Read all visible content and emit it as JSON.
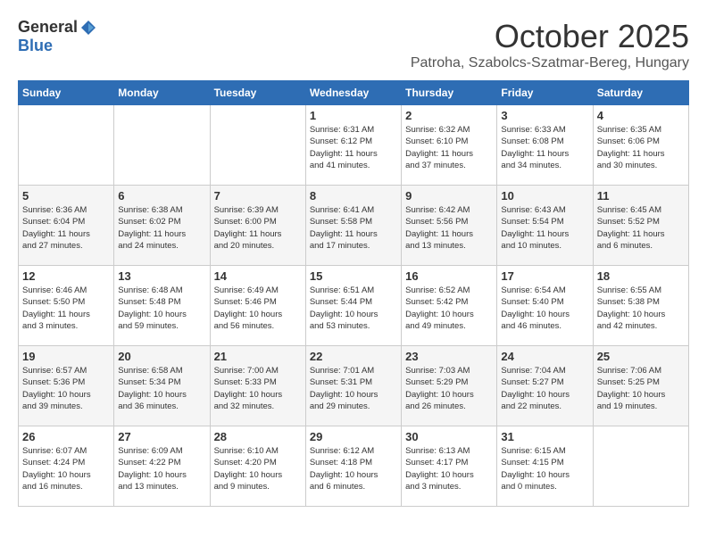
{
  "header": {
    "logo_general": "General",
    "logo_blue": "Blue",
    "month": "October 2025",
    "location": "Patroha, Szabolcs-Szatmar-Bereg, Hungary"
  },
  "weekdays": [
    "Sunday",
    "Monday",
    "Tuesday",
    "Wednesday",
    "Thursday",
    "Friday",
    "Saturday"
  ],
  "weeks": [
    [
      {
        "day": "",
        "info": ""
      },
      {
        "day": "",
        "info": ""
      },
      {
        "day": "",
        "info": ""
      },
      {
        "day": "1",
        "info": "Sunrise: 6:31 AM\nSunset: 6:12 PM\nDaylight: 11 hours\nand 41 minutes."
      },
      {
        "day": "2",
        "info": "Sunrise: 6:32 AM\nSunset: 6:10 PM\nDaylight: 11 hours\nand 37 minutes."
      },
      {
        "day": "3",
        "info": "Sunrise: 6:33 AM\nSunset: 6:08 PM\nDaylight: 11 hours\nand 34 minutes."
      },
      {
        "day": "4",
        "info": "Sunrise: 6:35 AM\nSunset: 6:06 PM\nDaylight: 11 hours\nand 30 minutes."
      }
    ],
    [
      {
        "day": "5",
        "info": "Sunrise: 6:36 AM\nSunset: 6:04 PM\nDaylight: 11 hours\nand 27 minutes."
      },
      {
        "day": "6",
        "info": "Sunrise: 6:38 AM\nSunset: 6:02 PM\nDaylight: 11 hours\nand 24 minutes."
      },
      {
        "day": "7",
        "info": "Sunrise: 6:39 AM\nSunset: 6:00 PM\nDaylight: 11 hours\nand 20 minutes."
      },
      {
        "day": "8",
        "info": "Sunrise: 6:41 AM\nSunset: 5:58 PM\nDaylight: 11 hours\nand 17 minutes."
      },
      {
        "day": "9",
        "info": "Sunrise: 6:42 AM\nSunset: 5:56 PM\nDaylight: 11 hours\nand 13 minutes."
      },
      {
        "day": "10",
        "info": "Sunrise: 6:43 AM\nSunset: 5:54 PM\nDaylight: 11 hours\nand 10 minutes."
      },
      {
        "day": "11",
        "info": "Sunrise: 6:45 AM\nSunset: 5:52 PM\nDaylight: 11 hours\nand 6 minutes."
      }
    ],
    [
      {
        "day": "12",
        "info": "Sunrise: 6:46 AM\nSunset: 5:50 PM\nDaylight: 11 hours\nand 3 minutes."
      },
      {
        "day": "13",
        "info": "Sunrise: 6:48 AM\nSunset: 5:48 PM\nDaylight: 10 hours\nand 59 minutes."
      },
      {
        "day": "14",
        "info": "Sunrise: 6:49 AM\nSunset: 5:46 PM\nDaylight: 10 hours\nand 56 minutes."
      },
      {
        "day": "15",
        "info": "Sunrise: 6:51 AM\nSunset: 5:44 PM\nDaylight: 10 hours\nand 53 minutes."
      },
      {
        "day": "16",
        "info": "Sunrise: 6:52 AM\nSunset: 5:42 PM\nDaylight: 10 hours\nand 49 minutes."
      },
      {
        "day": "17",
        "info": "Sunrise: 6:54 AM\nSunset: 5:40 PM\nDaylight: 10 hours\nand 46 minutes."
      },
      {
        "day": "18",
        "info": "Sunrise: 6:55 AM\nSunset: 5:38 PM\nDaylight: 10 hours\nand 42 minutes."
      }
    ],
    [
      {
        "day": "19",
        "info": "Sunrise: 6:57 AM\nSunset: 5:36 PM\nDaylight: 10 hours\nand 39 minutes."
      },
      {
        "day": "20",
        "info": "Sunrise: 6:58 AM\nSunset: 5:34 PM\nDaylight: 10 hours\nand 36 minutes."
      },
      {
        "day": "21",
        "info": "Sunrise: 7:00 AM\nSunset: 5:33 PM\nDaylight: 10 hours\nand 32 minutes."
      },
      {
        "day": "22",
        "info": "Sunrise: 7:01 AM\nSunset: 5:31 PM\nDaylight: 10 hours\nand 29 minutes."
      },
      {
        "day": "23",
        "info": "Sunrise: 7:03 AM\nSunset: 5:29 PM\nDaylight: 10 hours\nand 26 minutes."
      },
      {
        "day": "24",
        "info": "Sunrise: 7:04 AM\nSunset: 5:27 PM\nDaylight: 10 hours\nand 22 minutes."
      },
      {
        "day": "25",
        "info": "Sunrise: 7:06 AM\nSunset: 5:25 PM\nDaylight: 10 hours\nand 19 minutes."
      }
    ],
    [
      {
        "day": "26",
        "info": "Sunrise: 6:07 AM\nSunset: 4:24 PM\nDaylight: 10 hours\nand 16 minutes."
      },
      {
        "day": "27",
        "info": "Sunrise: 6:09 AM\nSunset: 4:22 PM\nDaylight: 10 hours\nand 13 minutes."
      },
      {
        "day": "28",
        "info": "Sunrise: 6:10 AM\nSunset: 4:20 PM\nDaylight: 10 hours\nand 9 minutes."
      },
      {
        "day": "29",
        "info": "Sunrise: 6:12 AM\nSunset: 4:18 PM\nDaylight: 10 hours\nand 6 minutes."
      },
      {
        "day": "30",
        "info": "Sunrise: 6:13 AM\nSunset: 4:17 PM\nDaylight: 10 hours\nand 3 minutes."
      },
      {
        "day": "31",
        "info": "Sunrise: 6:15 AM\nSunset: 4:15 PM\nDaylight: 10 hours\nand 0 minutes."
      },
      {
        "day": "",
        "info": ""
      }
    ]
  ]
}
